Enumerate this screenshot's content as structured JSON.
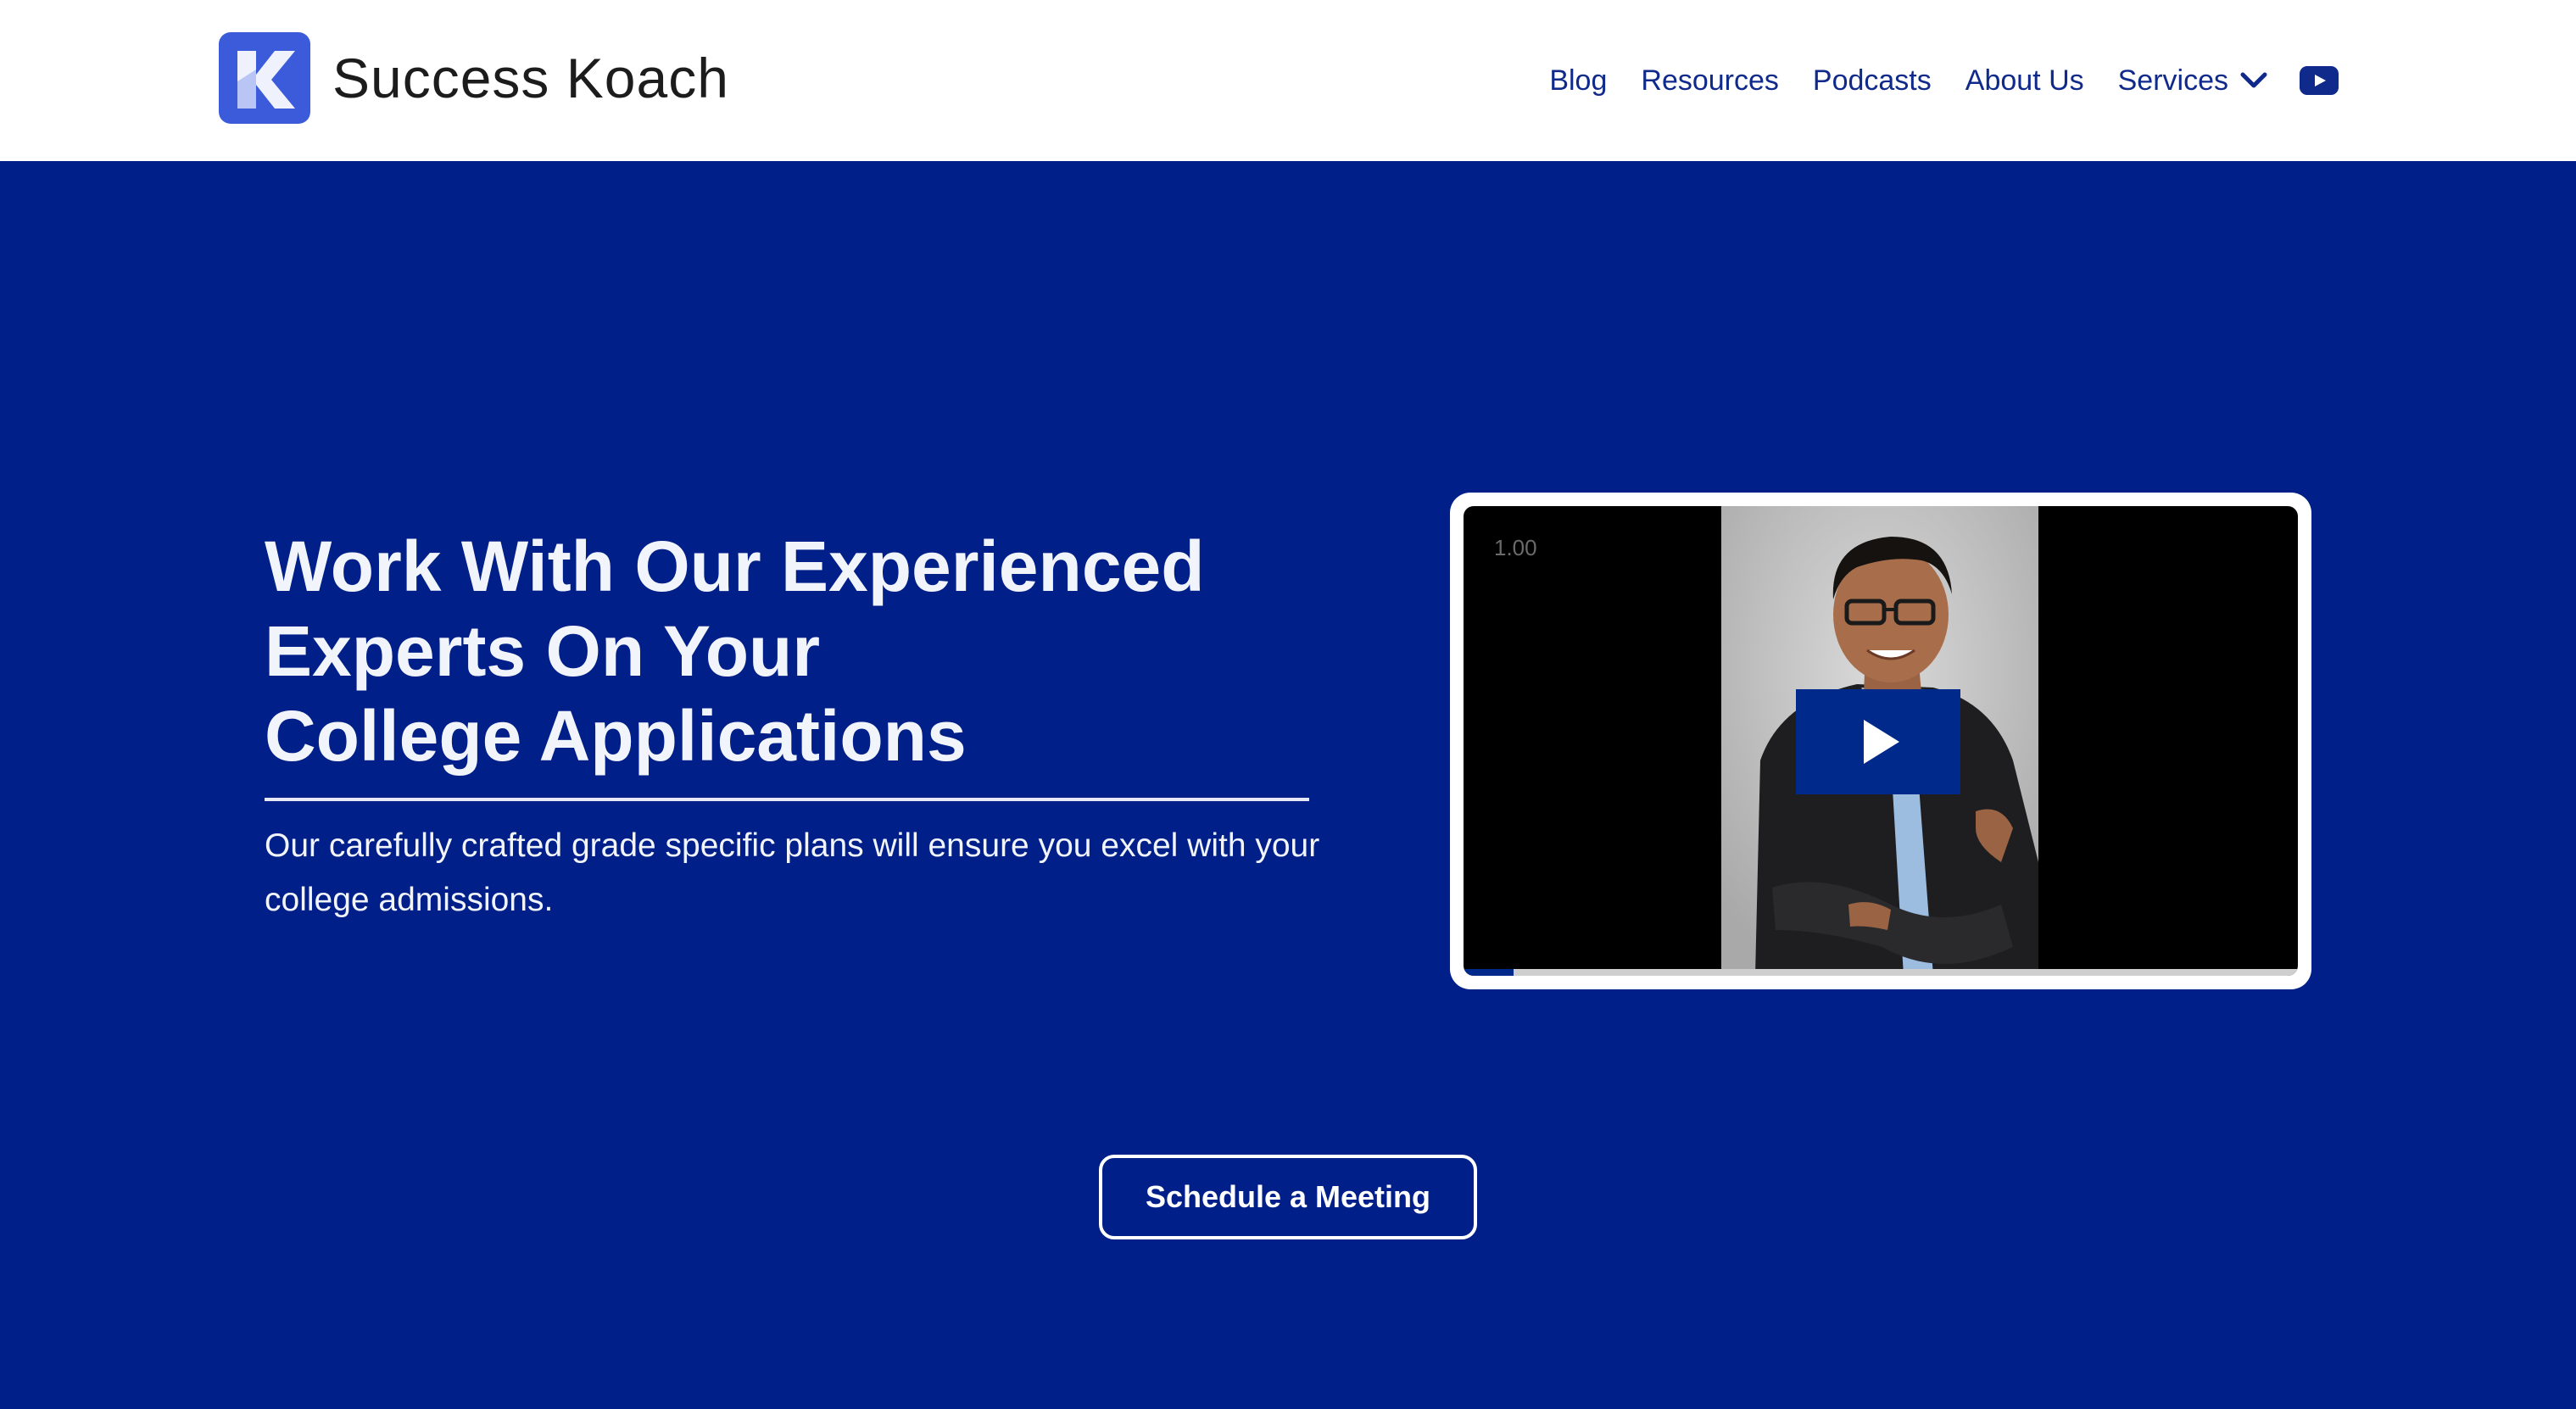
{
  "header": {
    "brand": "Success Koach",
    "nav": {
      "blog": "Blog",
      "resources": "Resources",
      "podcasts": "Podcasts",
      "about": "About Us",
      "services": "Services"
    },
    "icons": [
      "logo-k-icon",
      "chevron-down-icon",
      "youtube-icon"
    ]
  },
  "hero": {
    "title_lines": [
      "Work With Our Experienced",
      "Experts On Your",
      "College Applications"
    ],
    "subtitle": "Our carefully crafted grade specific plans will ensure you excel with your college admissions."
  },
  "video": {
    "speed_label": "1.00",
    "progress": 0.06,
    "icons": [
      "play-icon"
    ]
  },
  "cta": {
    "label": "Schedule a Meeting"
  },
  "colors": {
    "hero_background": "#001f88",
    "nav_text": "#0f2a8a",
    "logo_blue": "#3b5bdb",
    "play_button": "#00298c"
  }
}
